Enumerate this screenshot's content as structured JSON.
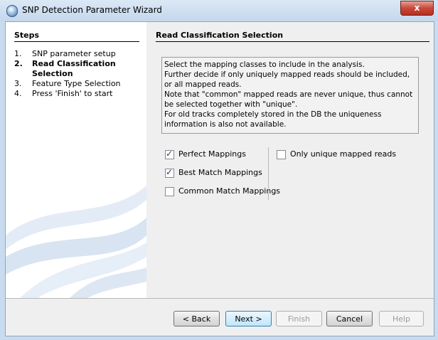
{
  "window": {
    "title": "SNP Detection Parameter Wizard",
    "close_label": "x"
  },
  "steps": {
    "heading": "Steps",
    "items": [
      {
        "num": "1.",
        "label": "SNP parameter setup",
        "active": false
      },
      {
        "num": "2.",
        "label": "Read Classification Selection",
        "active": true
      },
      {
        "num": "3.",
        "label": "Feature Type Selection",
        "active": false
      },
      {
        "num": "4.",
        "label": "Press 'Finish' to start",
        "active": false
      }
    ]
  },
  "content": {
    "title": "Read Classification Selection",
    "info_lines": [
      "Select the mapping classes to include in the analysis.",
      "Further decide if only uniquely mapped reads should be included, or all mapped reads.",
      "Note that \"common\" mapped reads are never unique, thus cannot be selected together with \"unique\".",
      "For old tracks completely stored in the DB the uniqueness information is also not available."
    ],
    "checkboxes": [
      {
        "label": "Perfect Mappings",
        "checked": true
      },
      {
        "label": "Best Match Mappings",
        "checked": true
      },
      {
        "label": "Common Match Mappings",
        "checked": false
      }
    ],
    "unique_checkbox": {
      "label": "Only unique mapped reads",
      "checked": false
    }
  },
  "buttons": {
    "back": "< Back",
    "next": "Next >",
    "finish": "Finish",
    "cancel": "Cancel",
    "help": "Help"
  },
  "colors": {
    "accent": "#3c7fb1",
    "swirl": "#d6e4f2"
  }
}
